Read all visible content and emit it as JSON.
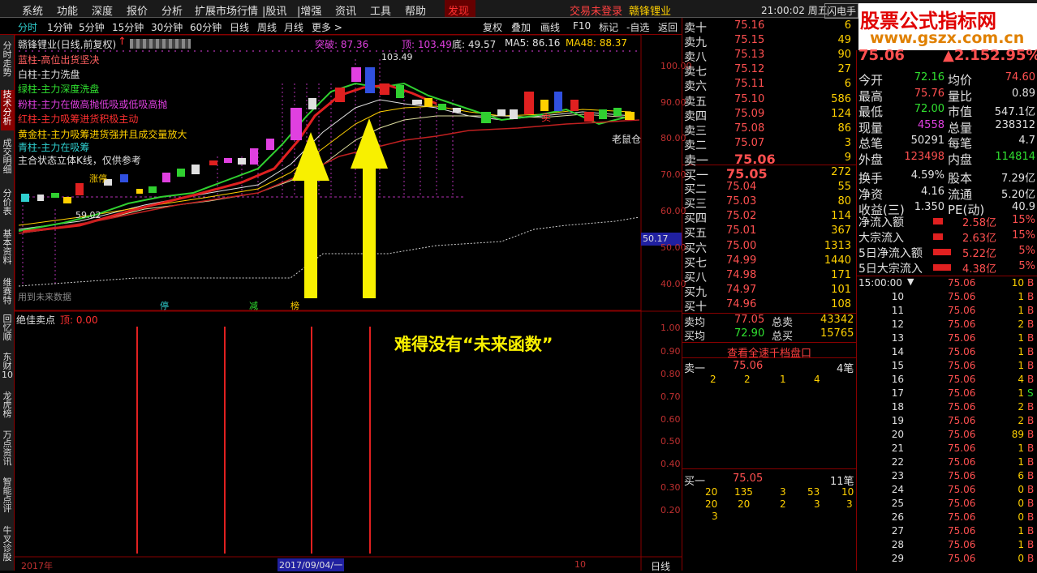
{
  "menu": {
    "items": [
      "系统",
      "功能",
      "深度",
      "报价",
      "分析",
      "扩展市场行情",
      "|股讯",
      "|增强",
      "资讯",
      "工具",
      "帮助",
      "发现"
    ],
    "trade_status": "交易未登录",
    "stock_name": "赣锋锂业",
    "clock": "21:00:02 周五",
    "flash": "闪电手"
  },
  "toolbar": {
    "periods": [
      "分时",
      "1分钟",
      "5分钟",
      "15分钟",
      "30分钟",
      "60分钟",
      "日线",
      "周线",
      "月线",
      "更多 >"
    ],
    "actions": [
      "复权",
      "叠加",
      "画线",
      "F10",
      "标记",
      "-自选",
      "返回"
    ]
  },
  "watermark": {
    "line1": "股票公式指标网",
    "line2": "www.gszx.com.cn"
  },
  "leftbar": [
    "分时走势",
    "技术分析",
    "成交明细",
    "分价表",
    "基本资料",
    "维赛特",
    "回忆顺",
    "东财10",
    "龙虎榜",
    "万点资讯",
    "智能点评",
    "牛叉诊股"
  ],
  "chart": {
    "title": "赣锋锂业(日线,前复权)",
    "high_label": "突破: 87.36",
    "top_label": "顶: 103.49",
    "bottom_label": "底: 49.57",
    "ma5": "MA5: 86.16",
    "ma48": "MA48: 88.37",
    "peak": "103.49",
    "low_mark": "59.02",
    "old_mouse": "老鼠仓",
    "sell_tag": "卖",
    "zhang": "涨停",
    "legend": [
      "蓝柱-高位出货坚决",
      "白柱-主力洗盘",
      "绿柱-主力深度洗盘",
      "粉柱-主力在做高抛低吸或低吸高抛",
      "红柱-主力吸筹进货积极主动",
      "黄金柱-主力吸筹进货强并且成交量放大",
      "青柱-主力在吸筹",
      "主合状态立体K线，仅供参考"
    ],
    "yaxis": [
      "100.00",
      "90.00",
      "80.00",
      "70.00",
      "60.00",
      "50.00",
      "40.00"
    ],
    "price_tag": "50.17",
    "future": "用到未来数据",
    "tags": [
      "停",
      "减",
      "榜"
    ]
  },
  "sub": {
    "title": "绝佳卖点",
    "top": "顶: 0.00",
    "yaxis": [
      "1.00",
      "0.90",
      "0.80",
      "0.70",
      "0.60",
      "0.50",
      "0.40",
      "0.30",
      "0.20"
    ],
    "annotation": "难得没有“未来函数”",
    "date_start": "2017年",
    "date_mid": "2017/09/04/一",
    "date_end": "10",
    "period": "日线"
  },
  "sell_book": [
    {
      "l": "卖十",
      "p": "75.16",
      "v": "6"
    },
    {
      "l": "卖九",
      "p": "75.15",
      "v": "49"
    },
    {
      "l": "卖八",
      "p": "75.13",
      "v": "90"
    },
    {
      "l": "卖七",
      "p": "75.12",
      "v": "27"
    },
    {
      "l": "卖六",
      "p": "75.11",
      "v": "6"
    },
    {
      "l": "卖五",
      "p": "75.10",
      "v": "586"
    },
    {
      "l": "卖四",
      "p": "75.09",
      "v": "124"
    },
    {
      "l": "卖三",
      "p": "75.08",
      "v": "86"
    },
    {
      "l": "卖二",
      "p": "75.07",
      "v": "3"
    },
    {
      "l": "卖一",
      "p": "75.06",
      "v": "9"
    }
  ],
  "buy_book": [
    {
      "l": "买一",
      "p": "75.05",
      "v": "272"
    },
    {
      "l": "买二",
      "p": "75.04",
      "v": "55"
    },
    {
      "l": "买三",
      "p": "75.03",
      "v": "80"
    },
    {
      "l": "买四",
      "p": "75.02",
      "v": "114"
    },
    {
      "l": "买五",
      "p": "75.01",
      "v": "367"
    },
    {
      "l": "买六",
      "p": "75.00",
      "v": "1313"
    },
    {
      "l": "买七",
      "p": "74.99",
      "v": "1440"
    },
    {
      "l": "买八",
      "p": "74.98",
      "v": "171"
    },
    {
      "l": "买九",
      "p": "74.97",
      "v": "101"
    },
    {
      "l": "买十",
      "p": "74.96",
      "v": "108"
    }
  ],
  "avg": {
    "sell_avg_l": "卖均",
    "sell_avg": "77.05",
    "sell_tot_l": "总卖",
    "sell_tot": "43342",
    "buy_avg_l": "买均",
    "buy_avg": "72.90",
    "buy_tot_l": "总买",
    "buy_tot": "15765"
  },
  "queue": {
    "btn": "查看全速千档盘口",
    "sell1": "卖一",
    "sell1_p": "75.06",
    "sell1_n": "4笔",
    "sell1_q": [
      "2",
      "2",
      "1",
      "4"
    ],
    "buy1": "买一",
    "buy1_p": "75.05",
    "buy1_n": "11笔",
    "buy1_q1": [
      "20",
      "135",
      "3",
      "53",
      "10"
    ],
    "buy1_q2": [
      "20",
      "20",
      "2",
      "3",
      "3"
    ],
    "buy1_q3": [
      "3"
    ]
  },
  "quote": {
    "price": "75.06",
    "chg": "2.15",
    "pct": "2.95%",
    "rows": [
      [
        "今开",
        "72.16",
        "均价",
        "74.60"
      ],
      [
        "最高",
        "75.76",
        "量比",
        "0.89"
      ],
      [
        "最低",
        "72.00",
        "市值",
        "547.1亿"
      ],
      [
        "现量",
        "4558",
        "总量",
        "238312"
      ],
      [
        "总笔",
        "50291",
        "每笔",
        "4.7"
      ],
      [
        "外盘",
        "123498",
        "内盘",
        "114814"
      ],
      [
        "换手",
        "4.59%",
        "股本",
        "7.29亿"
      ],
      [
        "净资",
        "4.16",
        "流通",
        "5.20亿"
      ],
      [
        "收益(三)",
        "1.350",
        "PE(动)",
        "40.9"
      ]
    ],
    "flows": [
      [
        "净流入额",
        "2.58亿",
        "15%"
      ],
      [
        "大宗流入",
        "2.63亿",
        "15%"
      ],
      [
        "5日净流入额",
        "5.22亿",
        "5%"
      ],
      [
        "5日大宗流入",
        "4.38亿",
        "5%"
      ]
    ]
  },
  "ticks": {
    "header": "15:00:00",
    "rows": [
      [
        "",
        "75.06",
        "10",
        "B"
      ],
      [
        "10",
        "75.06",
        "1",
        "B"
      ],
      [
        "11",
        "75.06",
        "1",
        "B"
      ],
      [
        "12",
        "75.06",
        "2",
        "B"
      ],
      [
        "13",
        "75.06",
        "1",
        "B"
      ],
      [
        "14",
        "75.06",
        "1",
        "B"
      ],
      [
        "15",
        "75.06",
        "1",
        "B"
      ],
      [
        "16",
        "75.06",
        "4",
        "B"
      ],
      [
        "17",
        "75.06",
        "1",
        "S"
      ],
      [
        "18",
        "75.06",
        "2",
        "B"
      ],
      [
        "19",
        "75.06",
        "2",
        "B"
      ],
      [
        "20",
        "75.06",
        "89",
        "B"
      ],
      [
        "21",
        "75.06",
        "1",
        "B"
      ],
      [
        "22",
        "75.06",
        "1",
        "B"
      ],
      [
        "23",
        "75.06",
        "6",
        "B"
      ],
      [
        "24",
        "75.06",
        "0",
        "B"
      ],
      [
        "25",
        "75.06",
        "0",
        "B"
      ],
      [
        "26",
        "75.06",
        "0",
        "B"
      ],
      [
        "27",
        "75.06",
        "1",
        "B"
      ],
      [
        "28",
        "75.06",
        "1",
        "B"
      ],
      [
        "29",
        "75.06",
        "0",
        "B"
      ]
    ]
  }
}
